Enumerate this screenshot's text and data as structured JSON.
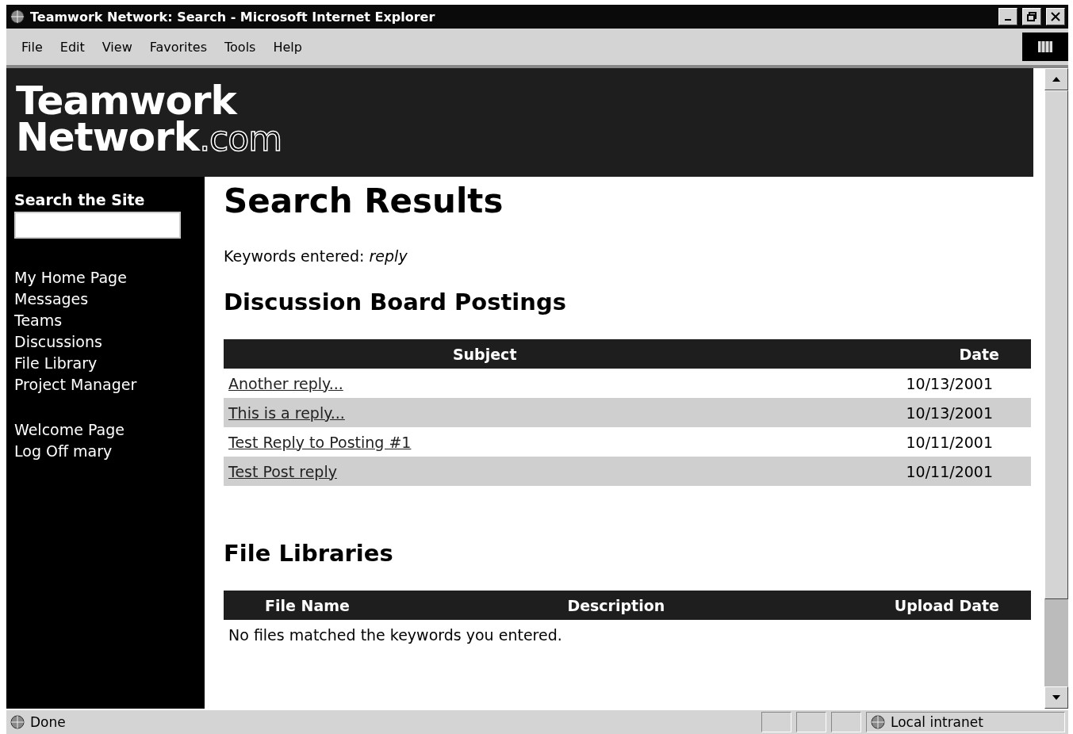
{
  "window": {
    "title": "Teamwork Network: Search - Microsoft Internet Explorer"
  },
  "menu": [
    "File",
    "Edit",
    "View",
    "Favorites",
    "Tools",
    "Help"
  ],
  "logo": {
    "line1": "Teamwork",
    "line2": "Network",
    "suffix": ".com"
  },
  "sidebar": {
    "search_label": "Search the Site",
    "links": [
      "My Home Page",
      "Messages",
      "Teams",
      "Discussions",
      "File Library",
      "Project Manager"
    ],
    "links2": [
      "Welcome Page",
      "Log Off mary"
    ]
  },
  "main": {
    "title": "Search Results",
    "keywords": "Keywords entered: *reply*",
    "postings": {
      "heading": "Discussion Board Postings",
      "columns": [
        "Subject",
        "Date"
      ],
      "rows": [
        {
          "subject": "Another reply...",
          "date": "10/13/2001",
          "shaded": false
        },
        {
          "subject": "This is a reply...",
          "date": "10/13/2001",
          "shaded": true
        },
        {
          "subject": "Test Reply to Posting #1",
          "date": "10/11/2001",
          "shaded": false
        },
        {
          "subject": "Test Post reply",
          "date": "10/11/2001",
          "shaded": true
        }
      ]
    },
    "files": {
      "heading": "File Libraries",
      "columns": [
        "File Name",
        "Description",
        "Upload Date"
      ],
      "empty": "No files matched the keywords you entered."
    }
  },
  "status_bar": {
    "text": "Done",
    "zone": "Local intranet"
  }
}
